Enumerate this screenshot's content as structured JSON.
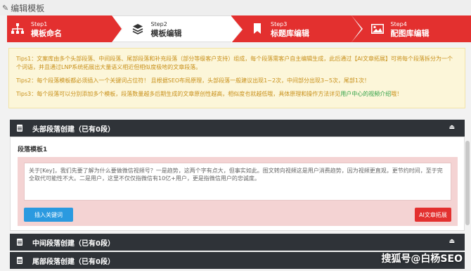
{
  "header": {
    "title": "编辑模板"
  },
  "steps": [
    {
      "small": "Step1",
      "label": "模板命名"
    },
    {
      "small": "Step2",
      "label": "模板编辑"
    },
    {
      "small": "Step3",
      "label": "标题库编辑"
    },
    {
      "small": "Step4",
      "label": "配图库编辑"
    }
  ],
  "tips": {
    "tip1": "Tips1：文案库由多个头部段落、中间段落、尾部段落和补充段落（部分等级客户支持）组成，每个段落需客户自主编辑生成，此后通过【AI文章拓展】可将每个段落拆分为一个个词语，并且通过LNP系统拓展出大量语义相近但相似度极地的文章段落。",
    "tip2": "Tips2：每个段落模板都必须插入一个关键词占位符！ 且根据SEO布局原理，头部段落一般建议出现1~2次，中间部分出现3~5次，尾部1次！",
    "tip3_a": "Tips3：每个段落可以分别添加多个模板，段落数量越多后期生成的文章原创性越高，相似度也就越低哦，具体原理和操作方法详见",
    "tip3_link": "用户中心的视频介绍",
    "tip3_b": "哦！"
  },
  "sections": {
    "head": {
      "title": "头部段落创建（已有0段）"
    },
    "middle": {
      "title": "中间段落创建（已有0段）"
    },
    "tail": {
      "title": "尾部段落创建（已有0段）"
    }
  },
  "paragraph": {
    "label": "段落模板1",
    "text": "关于[Key]，我们先要了解为什么要做微信视频号？一是趋势，这两个字有点大，但事实如此。图文转向视频这是用户消费趋势，因为视频更直观，更节约时间，至于完全取代可能性不大。二是用户，这里不仅仅指微信有10亿+用户，更是指微信用户的忠诚度。",
    "insert_btn": "插入关键词",
    "ai_btn": "AI文章拓展"
  },
  "watermark": "搜狐号@白杨SEO",
  "colors": {
    "accent": "#e3302f",
    "dark_bar": "#2f3338",
    "tip_text": "#c8901a",
    "link": "#2ea045",
    "blue_btn": "#2b9ae0"
  }
}
